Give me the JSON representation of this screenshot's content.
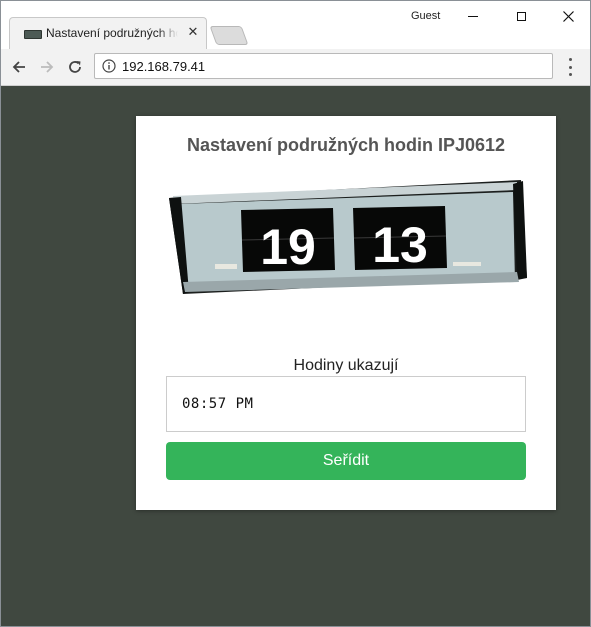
{
  "browser": {
    "tab_title": "Nastavení podružných hodin IPJ0612",
    "profile_label": "Guest",
    "url": "192.168.79.41",
    "icons": {
      "favicon": "clock-favicon-icon",
      "close_tab": "close-icon",
      "back": "arrow-left-icon",
      "forward": "arrow-right-icon",
      "reload": "reload-icon",
      "site_info": "info-icon",
      "menu": "kebab-menu-icon"
    }
  },
  "page": {
    "title": "Nastavení podružných hodin IPJ0612",
    "clock_image": {
      "hours": "19",
      "minutes": "13"
    },
    "time_field": {
      "label": "Hodiny ukazují",
      "value": "08:57 PM"
    },
    "submit_label": "Seřídit"
  },
  "colors": {
    "page_background": "#404840",
    "card_background": "#ffffff",
    "title_color": "#555555",
    "button_color": "#34b45a",
    "button_text": "#ffffff"
  }
}
